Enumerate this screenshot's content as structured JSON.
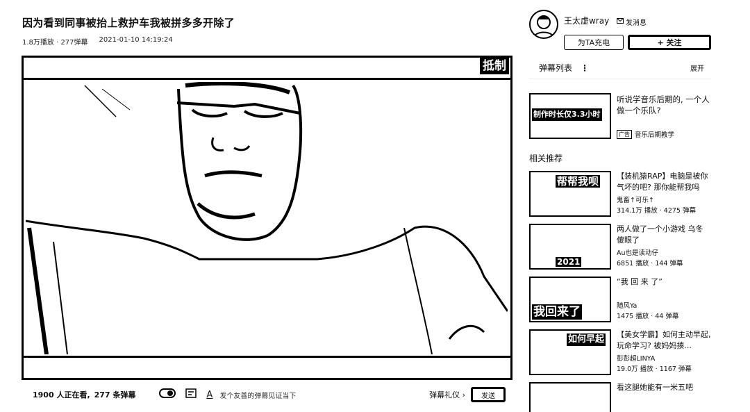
{
  "video": {
    "title": "因为看到同事被抬上救护车我被拼多多开除了",
    "stats": "1.8万播放 · 277弹幕",
    "date": "2021-01-10 14:19:24",
    "watermark": "抵制"
  },
  "controls": {
    "viewers": "1900 人正在看,",
    "danmaku_count": "277 条弹幕",
    "danmaku_toggle_icon": "danmaku-toggle-icon",
    "danmaku_settings_icon": "danmaku-settings-icon",
    "font_icon": "A",
    "danmaku_placeholder": "发个友善的弹幕见证当下",
    "etiquette": "弹幕礼仪 ›",
    "send": "发送"
  },
  "up": {
    "name": "王太虚wray",
    "message": "发消息",
    "charge": "为TA充电",
    "follow": "+ 关注"
  },
  "danmaku_list": {
    "label": "弹幕列表",
    "more": "⋮",
    "expand": "展开"
  },
  "ad": {
    "title": "听说学音乐后期的, 一个人做一个乐队?",
    "badge": "广告",
    "source": "音乐后期教学",
    "thumb_text": "制作时长仅3.3小时"
  },
  "related": {
    "title": "相关推荐",
    "items": [
      {
        "title": "【装机猿RAP】电脑是被你气坏的吧? 那你能帮我吗",
        "author": "鬼畜↑可乐↑",
        "stats": "314.1万 播放 · 4275 弹幕",
        "thumb_text": "帮帮我呗"
      },
      {
        "title": "两人做了一个小游戏 乌冬 傻眼了",
        "author": "Au也是读动仔",
        "stats": "6851 播放 · 144 弹幕",
        "thumb_text": "2021"
      },
      {
        "title": "“我 回 来 了”",
        "author": "随风Ya",
        "stats": "1475 播放 · 44 弹幕",
        "thumb_text": "我回来了"
      },
      {
        "title": "【美女学霸】如何主动早起, 玩命学习? 被妈妈揍...",
        "author": "彭彭超LINYA",
        "stats": "19.0万 播放 · 1167 弹幕",
        "thumb_text": "如何早起"
      },
      {
        "title": "看这腿她能有一米五吧",
        "author": "",
        "stats": "",
        "thumb_text": ""
      }
    ]
  }
}
